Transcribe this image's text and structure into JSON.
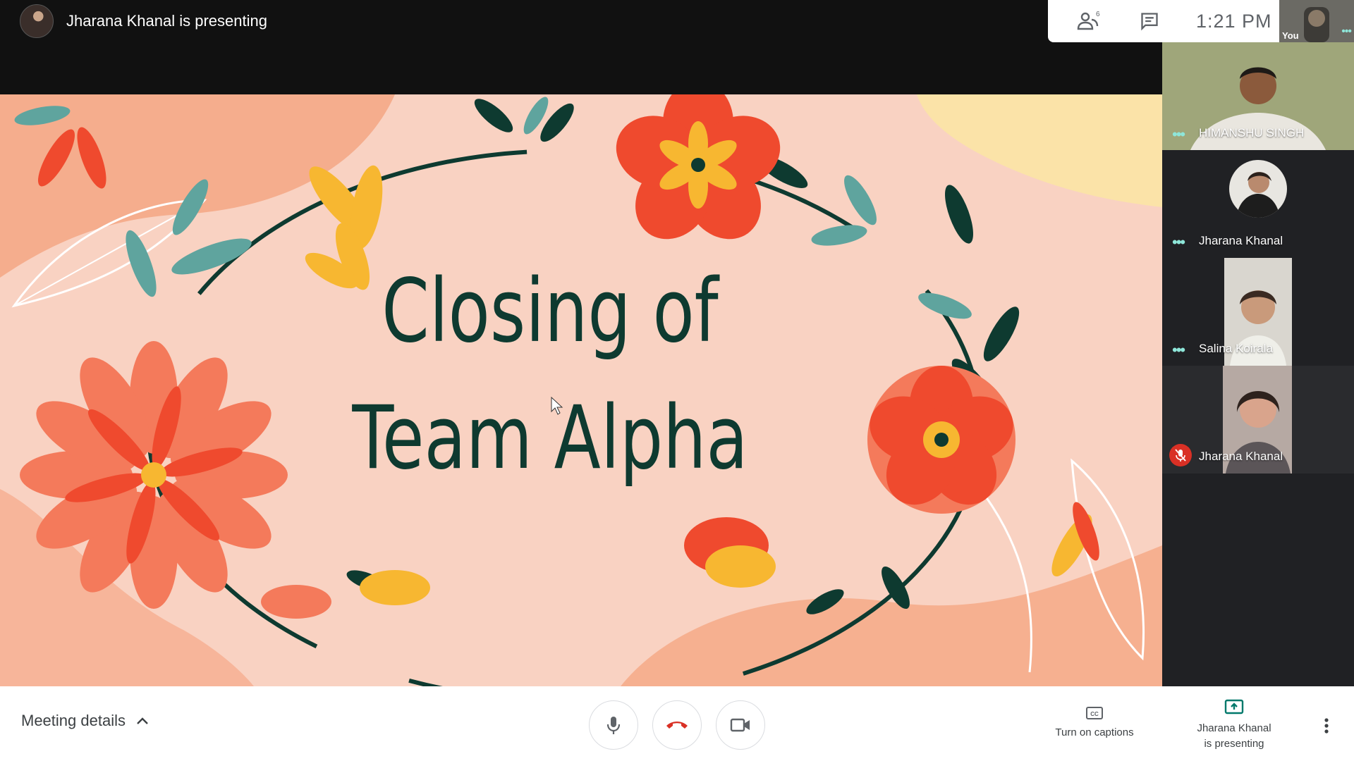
{
  "header": {
    "presenter_status": "Jharana Khanal is presenting"
  },
  "top_panel": {
    "people_count": "6",
    "time": "1:21  PM",
    "self_label": "You"
  },
  "slide": {
    "title_line1": "Closing of",
    "title_line2": "Team Alpha"
  },
  "participants": [
    {
      "name": "HIMANSHU SINGH",
      "muted": false
    },
    {
      "name": "Jharana Khanal",
      "muted": false
    },
    {
      "name": "Salina Koirala",
      "muted": false
    },
    {
      "name": "Jharana Khanal",
      "muted": true
    }
  ],
  "bottom_bar": {
    "meeting_details": "Meeting details",
    "captions_label": "Turn on captions",
    "presenting_line1": "Jharana Khanal",
    "presenting_line2": "is presenting"
  },
  "colors": {
    "accent_teal": "#00796b",
    "end_call_red": "#d93025",
    "slide_bg": "#f9d2c2",
    "title_green": "#0e3a30"
  }
}
